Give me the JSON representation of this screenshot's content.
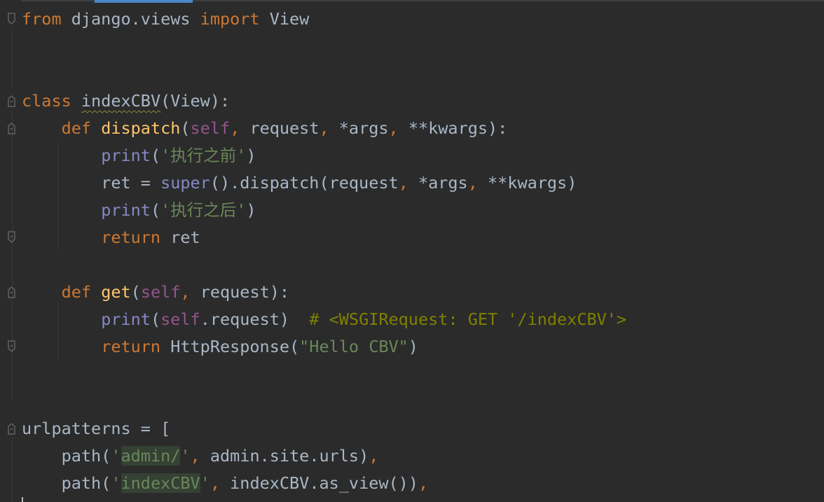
{
  "editor": {
    "colors": {
      "background": "#2b2b2b",
      "keyword": "#cc7832",
      "function": "#ffc66d",
      "self": "#94558d",
      "string": "#6a8759",
      "comment": "#808000",
      "builtin": "#8888c6",
      "default": "#a9b7c6"
    },
    "fold_icons": [
      "fold-marker-icon",
      "fold-end-icon"
    ],
    "lines": {
      "l1": {
        "kw_from": "from",
        "module": " django.views ",
        "kw_import": "import",
        "name": " View"
      },
      "l4": {
        "kw_class": "class",
        "sp": " ",
        "class_name": "indexCBV",
        "rest": "(View):"
      },
      "l5": {
        "indent": "    ",
        "kw_def": "def",
        "sp": " ",
        "fn_name": "dispatch",
        "open": "(",
        "self": "self",
        "comma1": ",",
        "p1": " request",
        "comma2": ",",
        "p2": " *args",
        "comma3": ",",
        "p3": " **kwargs):"
      },
      "l6": {
        "indent": "        ",
        "print": "print",
        "open": "(",
        "str": "'执行之前'",
        "close": ")"
      },
      "l7": {
        "indent": "        ",
        "a": "ret = ",
        "super": "super",
        "b": "().dispatch(request",
        "c1": ",",
        "b2": " *args",
        "c2": ",",
        "b3": " **kwargs)"
      },
      "l8": {
        "indent": "        ",
        "print": "print",
        "open": "(",
        "str": "'执行之后'",
        "close": ")"
      },
      "l9": {
        "indent": "        ",
        "kw_return": "return",
        "rest": " ret"
      },
      "l11": {
        "indent": "    ",
        "kw_def": "def",
        "sp": " ",
        "fn_name": "get",
        "open": "(",
        "self": "self",
        "comma1": ",",
        "rest": " request):"
      },
      "l12": {
        "indent": "        ",
        "print": "print",
        "open": "(",
        "self": "self",
        "rest": ".request)  ",
        "comment": "# <WSGIRequest: GET '/indexCBV'>"
      },
      "l13": {
        "indent": "        ",
        "kw_return": "return",
        "a": " HttpResponse(",
        "str": "\"Hello CBV\"",
        "close": ")"
      },
      "l16": {
        "text": "urlpatterns = ["
      },
      "l17": {
        "indent": "    ",
        "a": "path(",
        "q1": "'",
        "hl": "admin/",
        "q2": "'",
        "c": ",",
        "b": " admin.site.urls)",
        "c2": ","
      },
      "l18": {
        "indent": "    ",
        "a": "path(",
        "q1": "'",
        "hl": "indexCBV",
        "q2": "'",
        "c": ",",
        "b": " indexCBV.as_view())",
        "c2": ","
      }
    }
  }
}
